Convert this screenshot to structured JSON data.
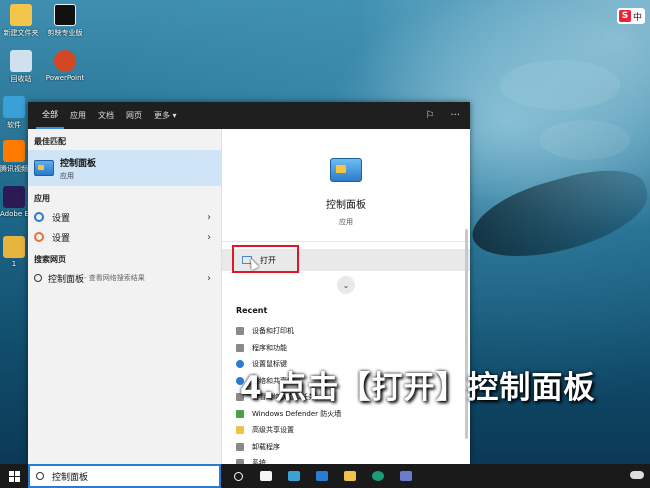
{
  "desktop": {
    "icons": [
      {
        "label": "新建文件夹",
        "color": "#f3c54a"
      },
      {
        "label": "剪映专业版",
        "color": "#111111"
      },
      {
        "label": "回收站",
        "color": "#cfe0ee"
      },
      {
        "label": "PowerPoint",
        "color": "#d24726"
      },
      {
        "label": "软件",
        "color": "#3aa0d8"
      },
      {
        "label": "腾讯视频",
        "color": "#ff7a00"
      },
      {
        "label": "Adobe Effects",
        "color": "#2b1a55"
      },
      {
        "label": "1",
        "color": "#e8b440"
      }
    ]
  },
  "ime": {
    "app_label": "S",
    "mode": "中"
  },
  "search_flyout": {
    "tabs": [
      {
        "label": "全部",
        "active": true
      },
      {
        "label": "应用"
      },
      {
        "label": "文档"
      },
      {
        "label": "网页"
      },
      {
        "label": "更多 ▾"
      }
    ],
    "header_icons": [
      "feedback-icon",
      "more-options-icon"
    ],
    "header_glyphs": {
      "feedback": "⚐",
      "more": "···"
    },
    "best_match": {
      "section": "最佳匹配",
      "title": "控制面板",
      "subtitle": "应用"
    },
    "apps": {
      "section": "应用",
      "items": [
        {
          "label": "设置",
          "icon": "settings-icon"
        },
        {
          "label": "设置",
          "icon": "settings-orange-icon"
        }
      ],
      "chevron": "›"
    },
    "web": {
      "section": "搜索网页",
      "query": "控制面板",
      "hint": " - 查看网络搜索结果",
      "chevron": "›"
    },
    "detail": {
      "title": "控制面板",
      "subtitle": "应用",
      "open_label": "打开",
      "expand_glyph": "⌄",
      "recent_title": "Recent",
      "recent": [
        {
          "label": "设备和打印机",
          "icon": "gray"
        },
        {
          "label": "程序和功能",
          "icon": "gray"
        },
        {
          "label": "设置鼠标键",
          "icon": "blue"
        },
        {
          "label": "网络和共享中心",
          "icon": "blue"
        },
        {
          "label": "查看网络状态和任务",
          "icon": "gray"
        },
        {
          "label": "Windows Defender 防火墙",
          "icon": "green"
        },
        {
          "label": "高级共享设置",
          "icon": "folder"
        },
        {
          "label": "卸载程序",
          "icon": "gray"
        },
        {
          "label": "系统",
          "icon": "gray"
        }
      ]
    }
  },
  "caption": "4.点击【打开】控制面板",
  "taskbar": {
    "search_value": "控制面板",
    "icons": [
      "task-view-icon",
      "store-icon",
      "people-icon",
      "mail-icon",
      "file-explorer-icon",
      "edge-icon",
      "app-icon"
    ]
  },
  "colors": {
    "accent": "#2a7bd4",
    "highlight_box": "#e0162b",
    "best_match_bg": "#cfe4f7"
  }
}
